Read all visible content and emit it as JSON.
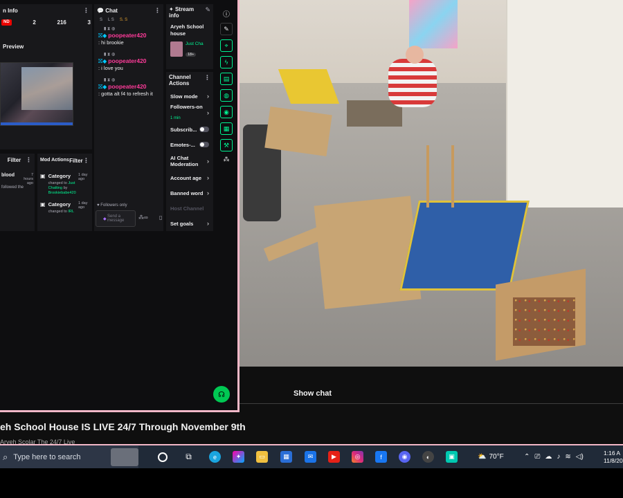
{
  "stream_info_panel": {
    "title": "n Info",
    "live_badge": "ND",
    "stats": [
      "2",
      "216",
      "3"
    ],
    "preview_label": "Preview"
  },
  "chat_panel": {
    "title": "Chat",
    "sub_badges": [
      "S",
      "L S",
      "S. S"
    ],
    "messages": [
      {
        "user": "poopeater420",
        "text": ": hi brookie"
      },
      {
        "user": "poopeater420",
        "text": ": i love you"
      },
      {
        "user": "poopeater420",
        "text": ": gotta alt f4 to refresh it"
      }
    ],
    "followers_only": "Followers only",
    "send_placeholder": "Send a message"
  },
  "stream_info_card": {
    "title": "Stream info",
    "stream_name": "Aryeh School house",
    "category": "Just Cha",
    "rating": "18+"
  },
  "channel_actions": {
    "title": "Channel Actions",
    "items": [
      {
        "label": "Slow mode",
        "control": "arrow"
      },
      {
        "label": "Followers-on",
        "sub": "1 min",
        "control": "arrow"
      },
      {
        "label": "Subscrib...",
        "control": "toggle"
      },
      {
        "label": "Emotes-...",
        "control": "toggle"
      },
      {
        "label": "AI Chat Moderation",
        "control": "arrow"
      },
      {
        "label": "Account age",
        "control": "arrow"
      },
      {
        "label": "Banned word",
        "control": "arrow"
      },
      {
        "label": "Host Channel",
        "control": "none"
      },
      {
        "label": "Set goals",
        "control": "arrow"
      }
    ]
  },
  "filter_panel": {
    "title": "Filter",
    "entry_text": "blood",
    "entry_time": "7 hours ago",
    "entry_desc": "followed the"
  },
  "mod_actions": {
    "title": "Mod Actions",
    "filter_label": "Filter",
    "entries": [
      {
        "type": "Category",
        "time": "1 day ago",
        "change": "changed to",
        "target": "Just Chatting",
        "by": "by",
        "user": "Brookiebabe420"
      },
      {
        "type": "Category",
        "time": "1 day ago",
        "change": "changed to",
        "target": "IRL",
        "by": "",
        "user": ""
      }
    ]
  },
  "video": {
    "show_chat": "Show chat",
    "title": "eh School House IS LIVE 24/7 Through November 9th",
    "subtitle": "Aryeh Scolar The 24/7 Live"
  },
  "taskbar": {
    "search_placeholder": "Type here to search",
    "weather": "70°F",
    "time": "1:16 A",
    "date": "11/8/20"
  },
  "colors": {
    "accent_green": "#00f593",
    "username_pink": "#ff3b9a",
    "border_pink": "#f3b8c8"
  }
}
